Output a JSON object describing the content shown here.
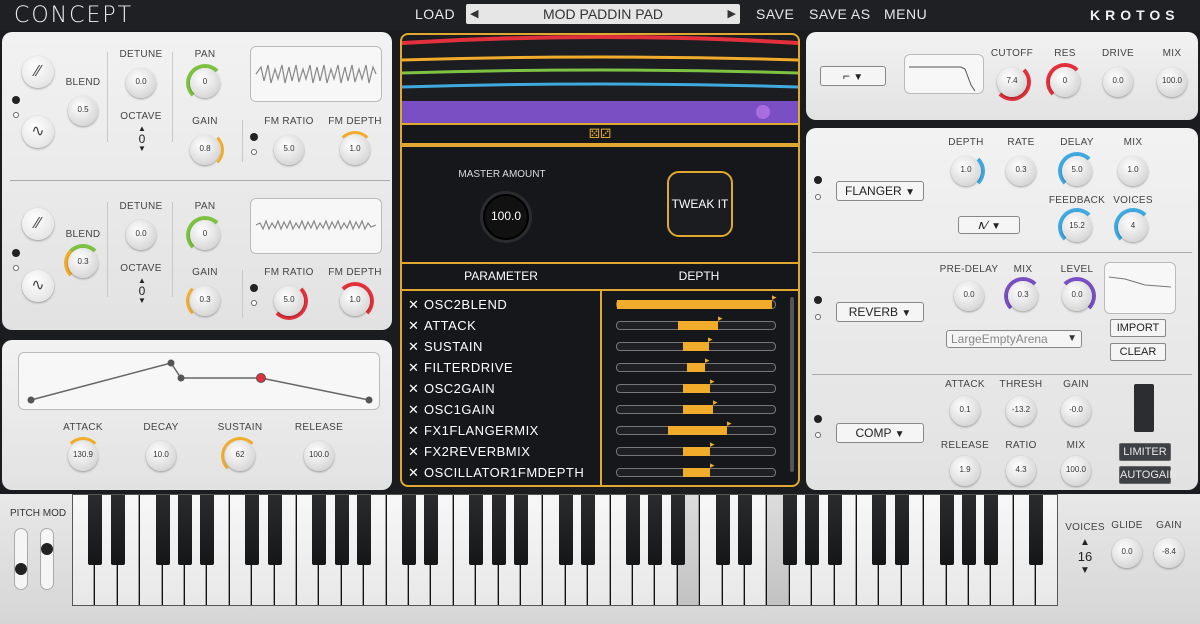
{
  "app": {
    "brand": "CONCEPT",
    "vendor": "KROTOS"
  },
  "menu": {
    "load": "LOAD",
    "preset_name": "MOD PADDIN PAD",
    "save": "SAVE",
    "save_as": "SAVE AS",
    "menu": "MENU"
  },
  "osc1": {
    "blend_label": "BLEND",
    "blend": "0.5",
    "detune_label": "DETUNE",
    "detune": "0.0",
    "octave_label": "OCTAVE",
    "octave": "0",
    "pan_label": "PAN",
    "pan": "0",
    "gain_label": "GAIN",
    "gain": "0.8",
    "fm_ratio_label": "FM RATIO",
    "fm_ratio": "5.0",
    "fm_depth_label": "FM DEPTH",
    "fm_depth": "1.0"
  },
  "osc2": {
    "blend_label": "BLEND",
    "blend": "0.3",
    "detune_label": "DETUNE",
    "detune": "0.0",
    "octave_label": "OCTAVE",
    "octave": "0",
    "pan_label": "PAN",
    "pan": "0",
    "gain_label": "GAIN",
    "gain": "0.3",
    "fm_ratio_label": "FM RATIO",
    "fm_ratio": "5.0",
    "fm_depth_label": "FM DEPTH",
    "fm_depth": "1.0"
  },
  "envelope": {
    "attack_label": "ATTACK",
    "attack": "130.9",
    "decay_label": "DECAY",
    "decay": "10.0",
    "sustain_label": "SUSTAIN",
    "sustain": "62",
    "release_label": "RELEASE",
    "release": "100.0"
  },
  "tweak": {
    "master_amount_label": "MASTER AMOUNT",
    "master_amount": "100.0",
    "tweak_button": "TWEAK IT",
    "parameter_header": "PARAMETER",
    "depth_header": "DEPTH",
    "rows": [
      {
        "name": "OSC2BLEND",
        "start": 0.0,
        "end": 0.97
      },
      {
        "name": "ATTACK",
        "start": 0.38,
        "end": 0.63
      },
      {
        "name": "SUSTAIN",
        "start": 0.41,
        "end": 0.57
      },
      {
        "name": "FILTERDRIVE",
        "start": 0.44,
        "end": 0.55
      },
      {
        "name": "OSC2GAIN",
        "start": 0.41,
        "end": 0.58
      },
      {
        "name": "OSC1GAIN",
        "start": 0.41,
        "end": 0.6
      },
      {
        "name": "FX1FLANGERMIX",
        "start": 0.32,
        "end": 0.69
      },
      {
        "name": "FX2REVERBMIX",
        "start": 0.41,
        "end": 0.58
      },
      {
        "name": "OSCILLATOR1FMDEPTH",
        "start": 0.41,
        "end": 0.58
      }
    ]
  },
  "filter": {
    "cutoff_label": "CUTOFF",
    "cutoff": "7.4",
    "res_label": "RES",
    "res": "0",
    "drive_label": "DRIVE",
    "drive": "0.0",
    "mix_label": "MIX",
    "mix": "100.0"
  },
  "fx1": {
    "type": "FLANGER",
    "depth_label": "DEPTH",
    "depth": "1.0",
    "rate_label": "RATE",
    "rate": "0.3",
    "delay_label": "DELAY",
    "delay": "5.0",
    "mix_label": "MIX",
    "mix": "1.0",
    "feedback_label": "FEEDBACK",
    "feedback": "15.2",
    "voices_label": "VOICES",
    "voices": "4"
  },
  "fx2": {
    "type": "REVERB",
    "predelay_label": "PRE-DELAY",
    "predelay": "0.0",
    "mix_label": "MIX",
    "mix": "0.3",
    "level_label": "LEVEL",
    "level": "0.0",
    "ir_name": "LargeEmptyArena",
    "import": "IMPORT",
    "clear": "CLEAR"
  },
  "fx3": {
    "type": "COMP",
    "attack_label": "ATTACK",
    "attack": "0.1",
    "thresh_label": "THRESH",
    "thresh": "-13.2",
    "gain_label": "GAIN",
    "gain": "-0.0",
    "release_label": "RELEASE",
    "release": "1.9",
    "ratio_label": "RATIO",
    "ratio": "4.3",
    "mix_label": "MIX",
    "mix": "100.0",
    "limiter": "LIMITER",
    "autogain": "AUTOGAIN"
  },
  "bottom": {
    "pitch_mod_label": "PITCH MOD",
    "voices_label": "VOICES",
    "voices": "16",
    "glide_label": "GLIDE",
    "glide": "0.0",
    "gain_label": "GAIN",
    "gain": "-8.4"
  },
  "colors": {
    "accent": "#f0ac2a",
    "green": "#7dc242",
    "red": "#e2313c",
    "blue": "#3fa9e0",
    "purple": "#7b4fc4"
  }
}
